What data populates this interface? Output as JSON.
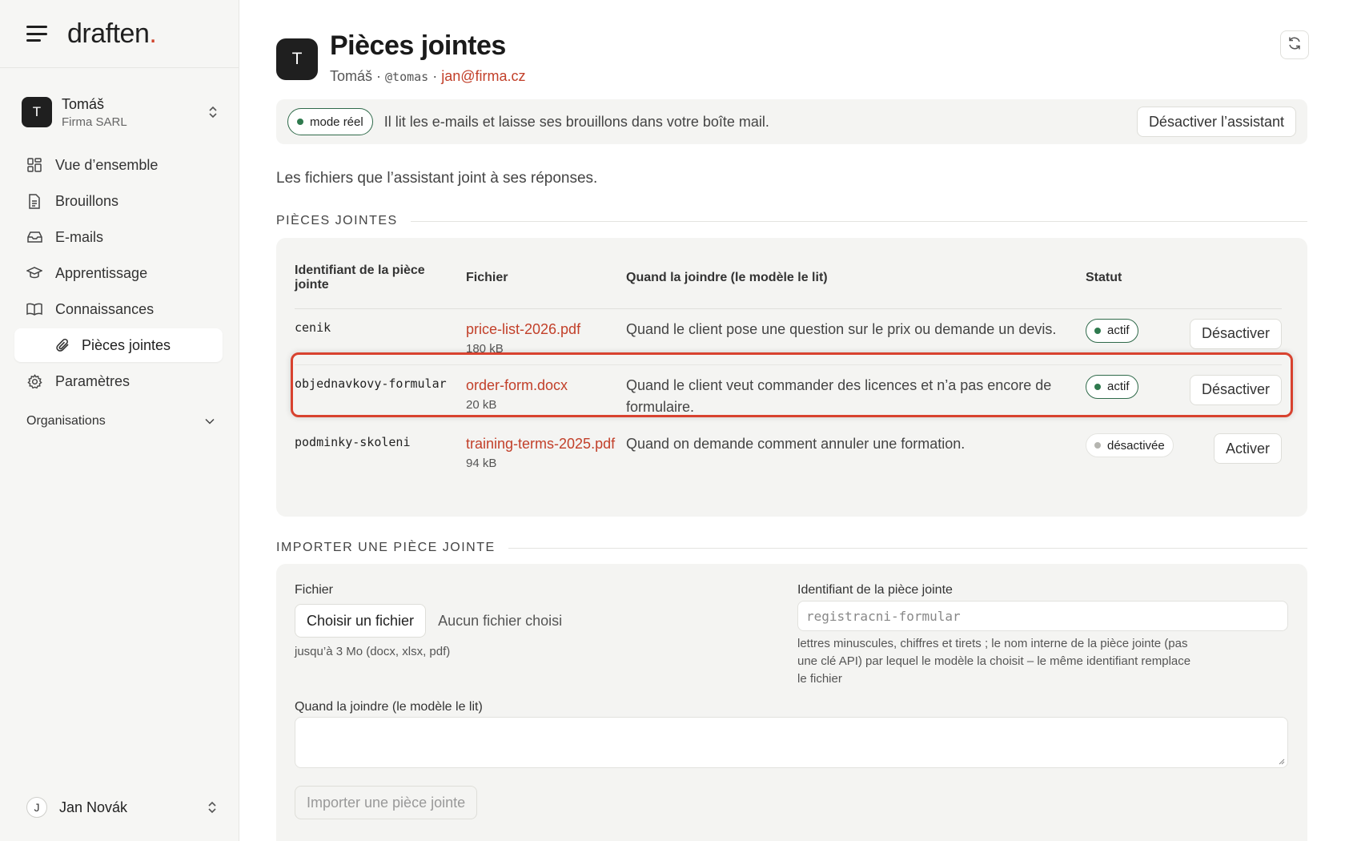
{
  "brand": {
    "name": "draften",
    "dot": "."
  },
  "org": {
    "initial": "T",
    "name": "Tomáš",
    "company": "Firma SARL"
  },
  "nav": {
    "items": [
      {
        "label": "Vue d’ensemble",
        "icon": "dashboard-icon"
      },
      {
        "label": "Brouillons",
        "icon": "document-icon"
      },
      {
        "label": "E-mails",
        "icon": "inbox-icon"
      },
      {
        "label": "Apprentissage",
        "icon": "graduation-cap-icon"
      },
      {
        "label": "Connaissances",
        "icon": "book-icon"
      }
    ],
    "sub_active": {
      "label": "Pièces jointes",
      "icon": "paperclip-icon"
    },
    "settings": {
      "label": "Paramètres",
      "icon": "gear-icon"
    },
    "organisations_label": "Organisations"
  },
  "user": {
    "initial": "J",
    "name": "Jan Novák"
  },
  "header": {
    "initial": "T",
    "title": "Pièces jointes",
    "name": "Tomáš",
    "sep": " · ",
    "handle": "@tomas",
    "email": "jan@firma.cz"
  },
  "banner": {
    "mode": "mode réel",
    "text": "Il lit les e-mails et laisse ses brouillons dans votre boîte mail.",
    "disable_button": "Désactiver l’assistant"
  },
  "intro": "Les fichiers que l’assistant joint à ses réponses.",
  "attachments": {
    "heading": "PIÈCES JOINTES",
    "columns": [
      "Identifiant de la pièce jointe",
      "Fichier",
      "Quand la joindre (le modèle le lit)",
      "Statut"
    ],
    "rows": [
      {
        "id": "cenik",
        "file": "price-list-2026.pdf",
        "size": "180 kB",
        "when": "Quand le client pose une question sur le prix ou demande un devis.",
        "status": "actif",
        "action": "Désactiver"
      },
      {
        "id": "objednavkovy-formular",
        "file": "order-form.docx",
        "size": "20 kB",
        "when": "Quand le client veut commander des licences et n’a pas encore de formulaire.",
        "status": "actif",
        "action": "Désactiver"
      },
      {
        "id": "podminky-skoleni",
        "file": "training-terms-2025.pdf",
        "size": "94 kB",
        "when": "Quand on demande comment annuler une formation.",
        "status": "désactivée",
        "action": "Activer"
      }
    ]
  },
  "upload": {
    "heading": "IMPORTER UNE PIÈCE JOINTE",
    "file_label": "Fichier",
    "choose_button": "Choisir un fichier",
    "no_file": "Aucun fichier choisi",
    "file_hint": "jusqu’à 3 Mo (docx, xlsx, pdf)",
    "id_label": "Identifiant de la pièce jointe",
    "id_placeholder": "registracni-formular",
    "id_hint": "lettres minuscules, chiffres et tirets ; le nom interne de la pièce jointe (pas une clé API) par lequel le modèle la choisit – le même identifiant remplace le fichier",
    "when_label": "Quand la joindre (le modèle le lit)",
    "submit_button": "Importer une pièce jointe"
  },
  "colors": {
    "accent": "#d0442b",
    "link": "#c2402a",
    "active_green": "#2f6a4a",
    "highlight": "#d8422f"
  }
}
